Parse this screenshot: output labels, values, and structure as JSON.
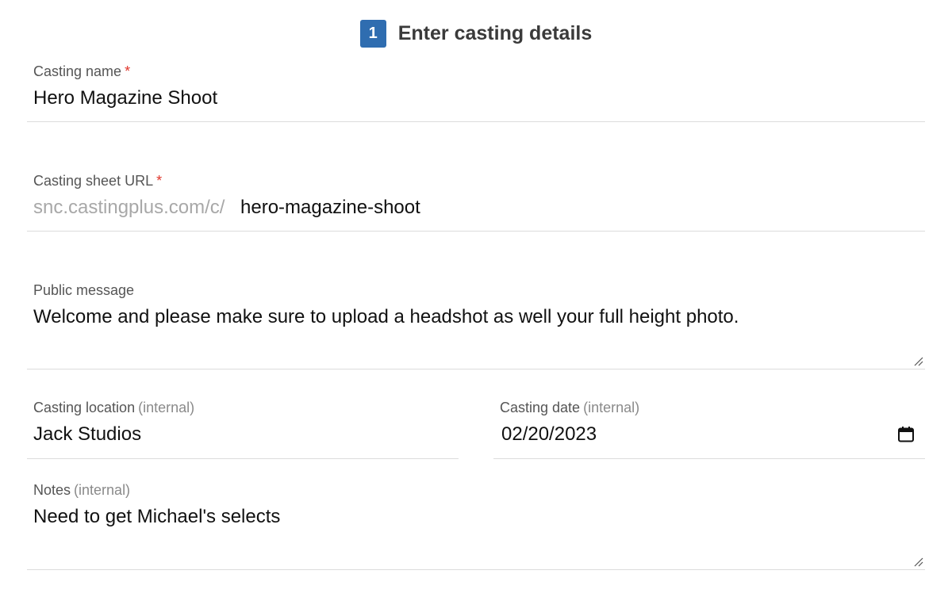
{
  "header": {
    "step_number": "1",
    "title": "Enter casting details"
  },
  "fields": {
    "casting_name": {
      "label": "Casting name",
      "required_mark": "*",
      "value": "Hero Magazine Shoot"
    },
    "casting_url": {
      "label": "Casting sheet URL",
      "required_mark": "*",
      "prefix": "snc.castingplus.com/c/",
      "value": "hero-magazine-shoot"
    },
    "public_message": {
      "label": "Public message",
      "value": "Welcome and please make sure to upload a headshot as well your full height photo."
    },
    "casting_location": {
      "label": "Casting location",
      "hint": "(internal)",
      "value": "Jack Studios"
    },
    "casting_date": {
      "label": "Casting date",
      "hint": "(internal)",
      "value": "02/20/2023",
      "icon": "calendar-icon"
    },
    "notes": {
      "label": "Notes",
      "hint": "(internal)",
      "value": "Need to get Michael's selects"
    }
  },
  "icons": {
    "textarea_resize": "resize-handle-icon"
  },
  "colors": {
    "accent": "#2f6db0",
    "required": "#e0352b",
    "divider": "#dcdcdc"
  }
}
